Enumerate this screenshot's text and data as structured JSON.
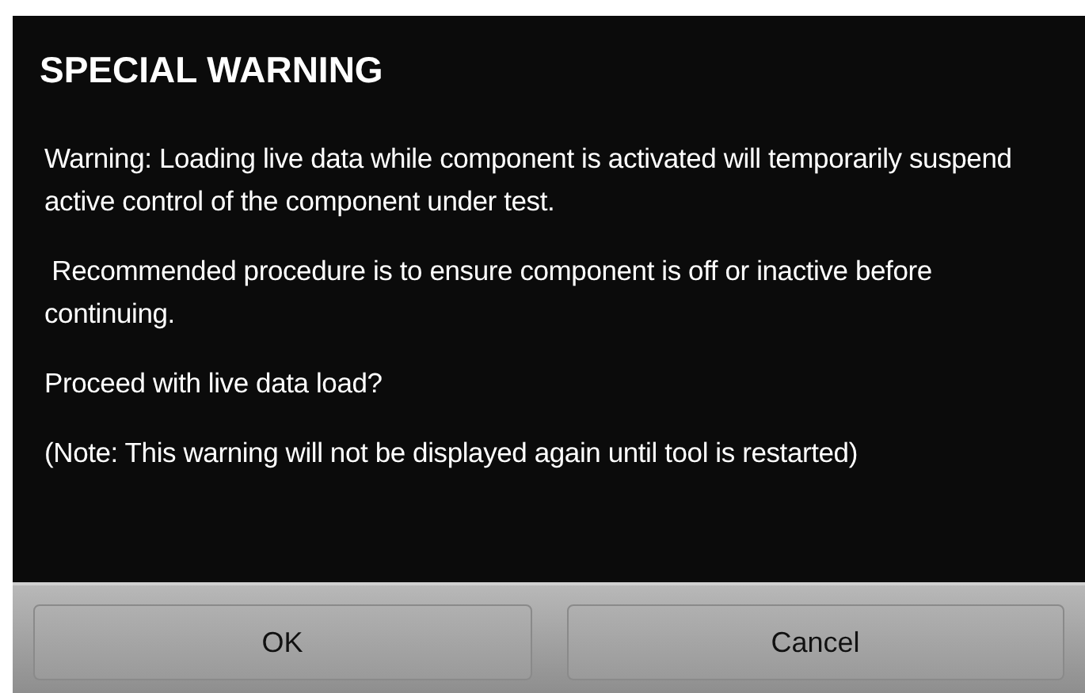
{
  "dialog": {
    "title": "SPECIAL WARNING",
    "paragraphs": [
      "Warning: Loading live data while component is activated will temporarily suspend active control of the component under test.",
      " Recommended procedure is to ensure component is off or inactive before continuing.",
      "Proceed with live data load?",
      "(Note: This warning will not be displayed again until tool is restarted)"
    ],
    "buttons": [
      "OK",
      "Cancel"
    ]
  }
}
